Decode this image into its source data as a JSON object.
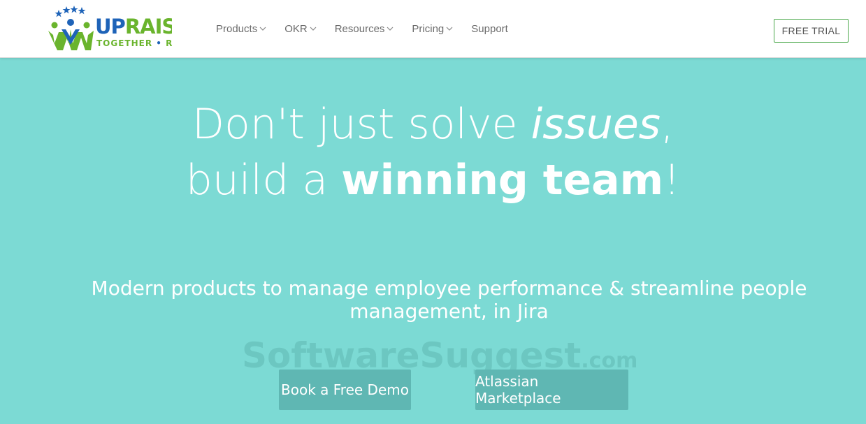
{
  "brand": {
    "name": "UPRAISE",
    "tagline": "TOGETHER • RISE",
    "colors": {
      "green": "#6ab42d",
      "blue": "#1e63b8"
    }
  },
  "nav": {
    "items": [
      {
        "label": "Products",
        "has_dropdown": true
      },
      {
        "label": "OKR",
        "has_dropdown": true
      },
      {
        "label": "Resources",
        "has_dropdown": true
      },
      {
        "label": "Pricing",
        "has_dropdown": true
      },
      {
        "label": "Support",
        "has_dropdown": false
      }
    ]
  },
  "header": {
    "cta_label": "FREE TRIAL"
  },
  "hero": {
    "line1_a": "Don't just solve ",
    "line1_em": "issues",
    "line1_b": ",",
    "line2_a": "build a ",
    "line2_strong": "winning team",
    "line2_b": "!",
    "subtitle": "Modern products to manage employee performance & streamline people management, in Jira",
    "buttons": {
      "demo": "Book a Free Demo",
      "marketplace": "Atlassian Marketplace"
    }
  },
  "watermark": {
    "text": "SoftwareSuggest",
    "suffix": ".com"
  },
  "theme": {
    "hero_bg": "#7cdad4",
    "button_bg": "#5fb7b3",
    "cta_border": "#4aa84a"
  }
}
